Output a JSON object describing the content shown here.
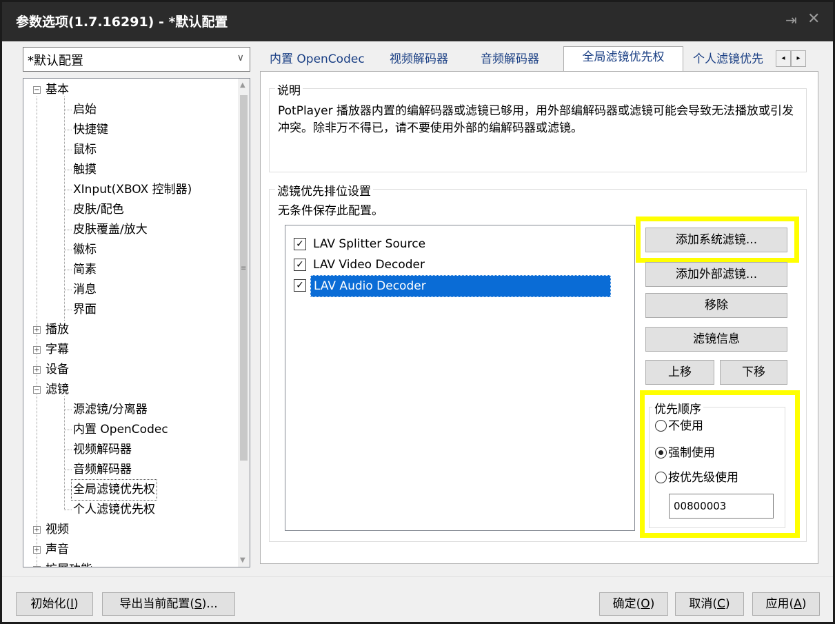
{
  "window": {
    "title": "参数选项(1.7.16291) - *默认配置",
    "pin_glyph": "⇥",
    "close_glyph": "✕"
  },
  "profile_combo": {
    "value": "*默认配置",
    "arrow": "∨"
  },
  "tree": {
    "items": [
      {
        "label": "基本",
        "exp": "−"
      },
      {
        "label": "启始"
      },
      {
        "label": "快捷键"
      },
      {
        "label": "鼠标"
      },
      {
        "label": "触摸"
      },
      {
        "label": "XInput(XBOX 控制器)"
      },
      {
        "label": "皮肤/配色"
      },
      {
        "label": "皮肤覆盖/放大"
      },
      {
        "label": "徽标"
      },
      {
        "label": "简素"
      },
      {
        "label": "消息"
      },
      {
        "label": "界面"
      },
      {
        "label": "播放",
        "exp": "+"
      },
      {
        "label": "字幕",
        "exp": "+"
      },
      {
        "label": "设备",
        "exp": "+"
      },
      {
        "label": "滤镜",
        "exp": "−"
      },
      {
        "label": "源滤镜/分离器"
      },
      {
        "label": "内置 OpenCodec"
      },
      {
        "label": "视频解码器"
      },
      {
        "label": "音频解码器"
      },
      {
        "label": "全局滤镜优先权"
      },
      {
        "label": "个人滤镜优先权"
      },
      {
        "label": "视频",
        "exp": "+"
      },
      {
        "label": "声音",
        "exp": "+"
      },
      {
        "label": "扩展功能",
        "exp": "+"
      }
    ]
  },
  "tabs": [
    {
      "label": "内置 OpenCodec"
    },
    {
      "label": "视频解码器"
    },
    {
      "label": "音频解码器"
    },
    {
      "label": "全局滤镜优先权"
    },
    {
      "label": "个人滤镜优先"
    }
  ],
  "tab_scroll": {
    "left": "◂",
    "right": "▸"
  },
  "description": {
    "title": "说明",
    "text": "PotPlayer 播放器内置的编解码器或滤镜已够用，用外部编解码器或滤镜可能会导致无法播放或引发冲突。除非万不得已，请不要使用外部的编解码器或滤镜。"
  },
  "filter_priority": {
    "title": "滤镜优先排位设置",
    "note": "无条件保存此配置。",
    "filters": [
      {
        "name": "LAV Splitter Source",
        "check": "✓"
      },
      {
        "name": "LAV Video Decoder",
        "check": "✓"
      },
      {
        "name": "LAV Audio Decoder",
        "check": "✓"
      }
    ],
    "buttons": {
      "add_system": "添加系统滤镜...",
      "add_external": "添加外部滤镜...",
      "remove": "移除",
      "info": "滤镜信息",
      "move_up": "上移",
      "move_down": "下移"
    }
  },
  "priority_order": {
    "title": "优先顺序",
    "options": [
      "不使用",
      "强制使用",
      "按优先级使用"
    ],
    "selected": "强制使用",
    "value": "00800003"
  },
  "footer": {
    "init": {
      "text": "初始化(",
      "key": "I",
      "end": ")"
    },
    "export": {
      "text": "导出当前配置(",
      "key": "S",
      "end": ")..."
    },
    "ok": {
      "text": "确定(",
      "key": "O",
      "end": ")"
    },
    "cancel": {
      "text": "取消(",
      "key": "C",
      "end": ")"
    },
    "apply": {
      "text": "应用(",
      "key": "A",
      "end": ")"
    }
  }
}
